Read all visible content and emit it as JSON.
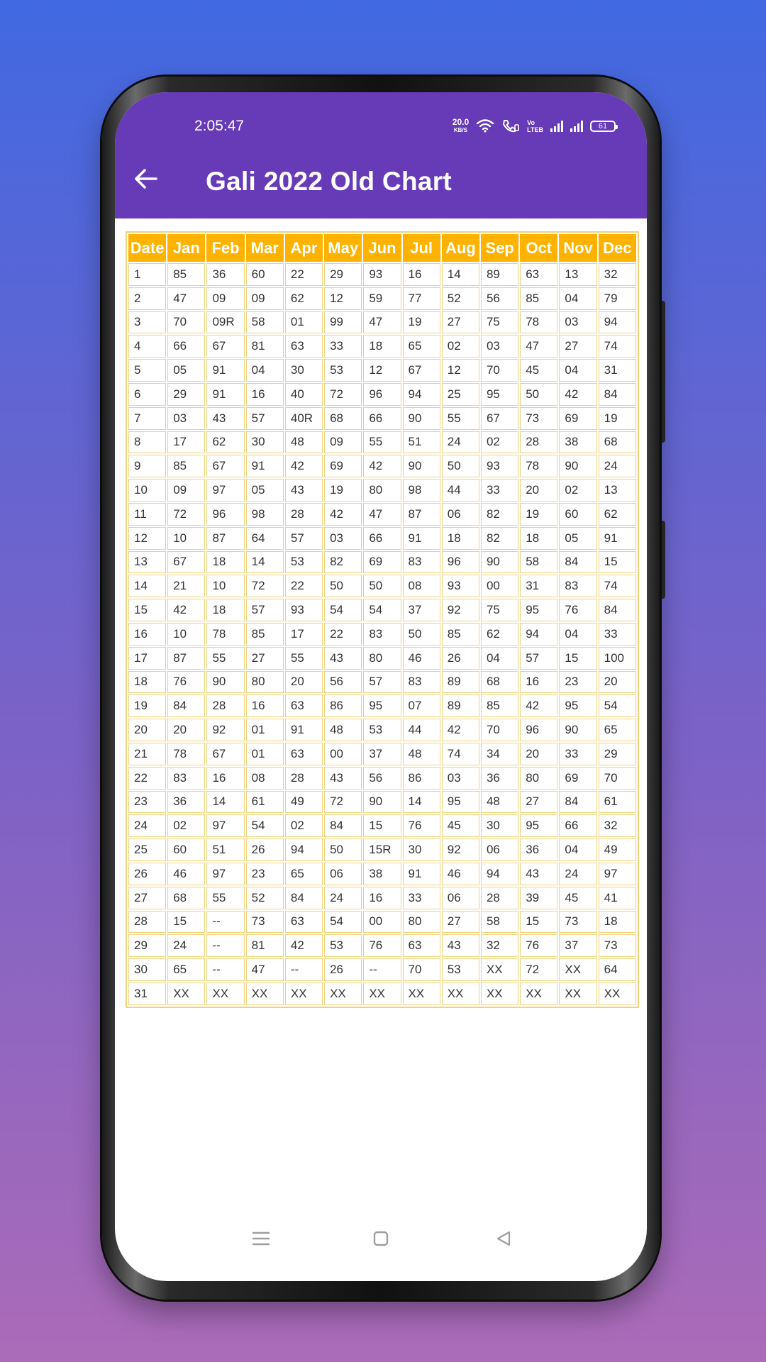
{
  "status_bar": {
    "time": "2:05:47",
    "net_speed_value": "20.0",
    "net_speed_unit": "KB/S",
    "volte_top": "Vo",
    "volte_bottom": "LTEB",
    "battery": "61"
  },
  "app_bar": {
    "back_icon": "arrow-left-icon",
    "title": "Gali 2022 Old Chart"
  },
  "colors": {
    "app_bar": "#673ab7",
    "header_cell": "#ffb300",
    "cell_border": "#f0d27a"
  },
  "chart": {
    "headers": [
      "Date",
      "Jan",
      "Feb",
      "Mar",
      "Apr",
      "May",
      "Jun",
      "Jul",
      "Aug",
      "Sep",
      "Oct",
      "Nov",
      "Dec"
    ],
    "rows": [
      [
        "1",
        "85",
        "36",
        "60",
        "22",
        "29",
        "93",
        "16",
        "14",
        "89",
        "63",
        "13",
        "32"
      ],
      [
        "2",
        "47",
        "09",
        "09",
        "62",
        "12",
        "59",
        "77",
        "52",
        "56",
        "85",
        "04",
        "79"
      ],
      [
        "3",
        "70",
        "09R",
        "58",
        "01",
        "99",
        "47",
        "19",
        "27",
        "75",
        "78",
        "03",
        "94"
      ],
      [
        "4",
        "66",
        "67",
        "81",
        "63",
        "33",
        "18",
        "65",
        "02",
        "03",
        "47",
        "27",
        "74"
      ],
      [
        "5",
        "05",
        "91",
        "04",
        "30",
        "53",
        "12",
        "67",
        "12",
        "70",
        "45",
        "04",
        "31"
      ],
      [
        "6",
        "29",
        "91",
        "16",
        "40",
        "72",
        "96",
        "94",
        "25",
        "95",
        "50",
        "42",
        "84"
      ],
      [
        "7",
        "03",
        "43",
        "57",
        "40R",
        "68",
        "66",
        "90",
        "55",
        "67",
        "73",
        "69",
        "19"
      ],
      [
        "8",
        "17",
        "62",
        "30",
        "48",
        "09",
        "55",
        "51",
        "24",
        "02",
        "28",
        "38",
        "68"
      ],
      [
        "9",
        "85",
        "67",
        "91",
        "42",
        "69",
        "42",
        "90",
        "50",
        "93",
        "78",
        "90",
        "24"
      ],
      [
        "10",
        "09",
        "97",
        "05",
        "43",
        "19",
        "80",
        "98",
        "44",
        "33",
        "20",
        "02",
        "13"
      ],
      [
        "11",
        "72",
        "96",
        "98",
        "28",
        "42",
        "47",
        "87",
        "06",
        "82",
        "19",
        "60",
        "62"
      ],
      [
        "12",
        "10",
        "87",
        "64",
        "57",
        "03",
        "66",
        "91",
        "18",
        "82",
        "18",
        "05",
        "91"
      ],
      [
        "13",
        "67",
        "18",
        "14",
        "53",
        "82",
        "69",
        "83",
        "96",
        "90",
        "58",
        "84",
        "15"
      ],
      [
        "14",
        "21",
        "10",
        "72",
        "22",
        "50",
        "50",
        "08",
        "93",
        "00",
        "31",
        "83",
        "74"
      ],
      [
        "15",
        "42",
        "18",
        "57",
        "93",
        "54",
        "54",
        "37",
        "92",
        "75",
        "95",
        "76",
        "84"
      ],
      [
        "16",
        "10",
        "78",
        "85",
        "17",
        "22",
        "83",
        "50",
        "85",
        "62",
        "94",
        "04",
        "33"
      ],
      [
        "17",
        "87",
        "55",
        "27",
        "55",
        "43",
        "80",
        "46",
        "26",
        "04",
        "57",
        "15",
        "100"
      ],
      [
        "18",
        "76",
        "90",
        "80",
        "20",
        "56",
        "57",
        "83",
        "89",
        "68",
        "16",
        "23",
        "20"
      ],
      [
        "19",
        "84",
        "28",
        "16",
        "63",
        "86",
        "95",
        "07",
        "89",
        "85",
        "42",
        "95",
        "54"
      ],
      [
        "20",
        "20",
        "92",
        "01",
        "91",
        "48",
        "53",
        "44",
        "42",
        "70",
        "96",
        "90",
        "65"
      ],
      [
        "21",
        "78",
        "67",
        "01",
        "63",
        "00",
        "37",
        "48",
        "74",
        "34",
        "20",
        "33",
        "29"
      ],
      [
        "22",
        "83",
        "16",
        "08",
        "28",
        "43",
        "56",
        "86",
        "03",
        "36",
        "80",
        "69",
        "70"
      ],
      [
        "23",
        "36",
        "14",
        "61",
        "49",
        "72",
        "90",
        "14",
        "95",
        "48",
        "27",
        "84",
        "61"
      ],
      [
        "24",
        "02",
        "97",
        "54",
        "02",
        "84",
        "15",
        "76",
        "45",
        "30",
        "95",
        "66",
        "32"
      ],
      [
        "25",
        "60",
        "51",
        "26",
        "94",
        "50",
        "15R",
        "30",
        "92",
        "06",
        "36",
        "04",
        "49"
      ],
      [
        "26",
        "46",
        "97",
        "23",
        "65",
        "06",
        "38",
        "91",
        "46",
        "94",
        "43",
        "24",
        "97"
      ],
      [
        "27",
        "68",
        "55",
        "52",
        "84",
        "24",
        "16",
        "33",
        "06",
        "28",
        "39",
        "45",
        "41"
      ],
      [
        "28",
        "15",
        "--",
        "73",
        "63",
        "54",
        "00",
        "80",
        "27",
        "58",
        "15",
        "73",
        "18"
      ],
      [
        "29",
        "24",
        "--",
        "81",
        "42",
        "53",
        "76",
        "63",
        "43",
        "32",
        "76",
        "37",
        "73"
      ],
      [
        "30",
        "65",
        "--",
        "47",
        "--",
        "26",
        "--",
        "70",
        "53",
        "XX",
        "72",
        "XX",
        "64"
      ],
      [
        "31",
        "XX",
        "XX",
        "XX",
        "XX",
        "XX",
        "XX",
        "XX",
        "XX",
        "XX",
        "XX",
        "XX",
        "XX"
      ]
    ]
  },
  "nav_bar": {
    "menu_icon": "menu-icon",
    "home_icon": "home-square-icon",
    "back_icon": "back-triangle-icon"
  }
}
